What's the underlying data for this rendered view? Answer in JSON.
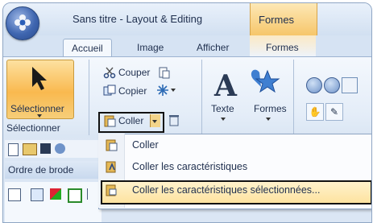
{
  "window": {
    "title": "Sans titre - Layout & Editing",
    "context_tab": "Formes"
  },
  "tabs": [
    "Accueil",
    "Image",
    "Afficher",
    "Formes"
  ],
  "ribbon": {
    "select_label": "Sélectionner",
    "select_group_label": "Sélectionner",
    "cut_label": "Couper",
    "copy_label": "Copier",
    "paste_label": "Coller",
    "text_label": "Texte",
    "shapes_label": "Formes"
  },
  "panel": {
    "label": "Ordre de brode"
  },
  "menu": {
    "items": [
      "Coller",
      "Coller les caractéristiques",
      "Coller les caractéristiques sélectionnées..."
    ]
  }
}
